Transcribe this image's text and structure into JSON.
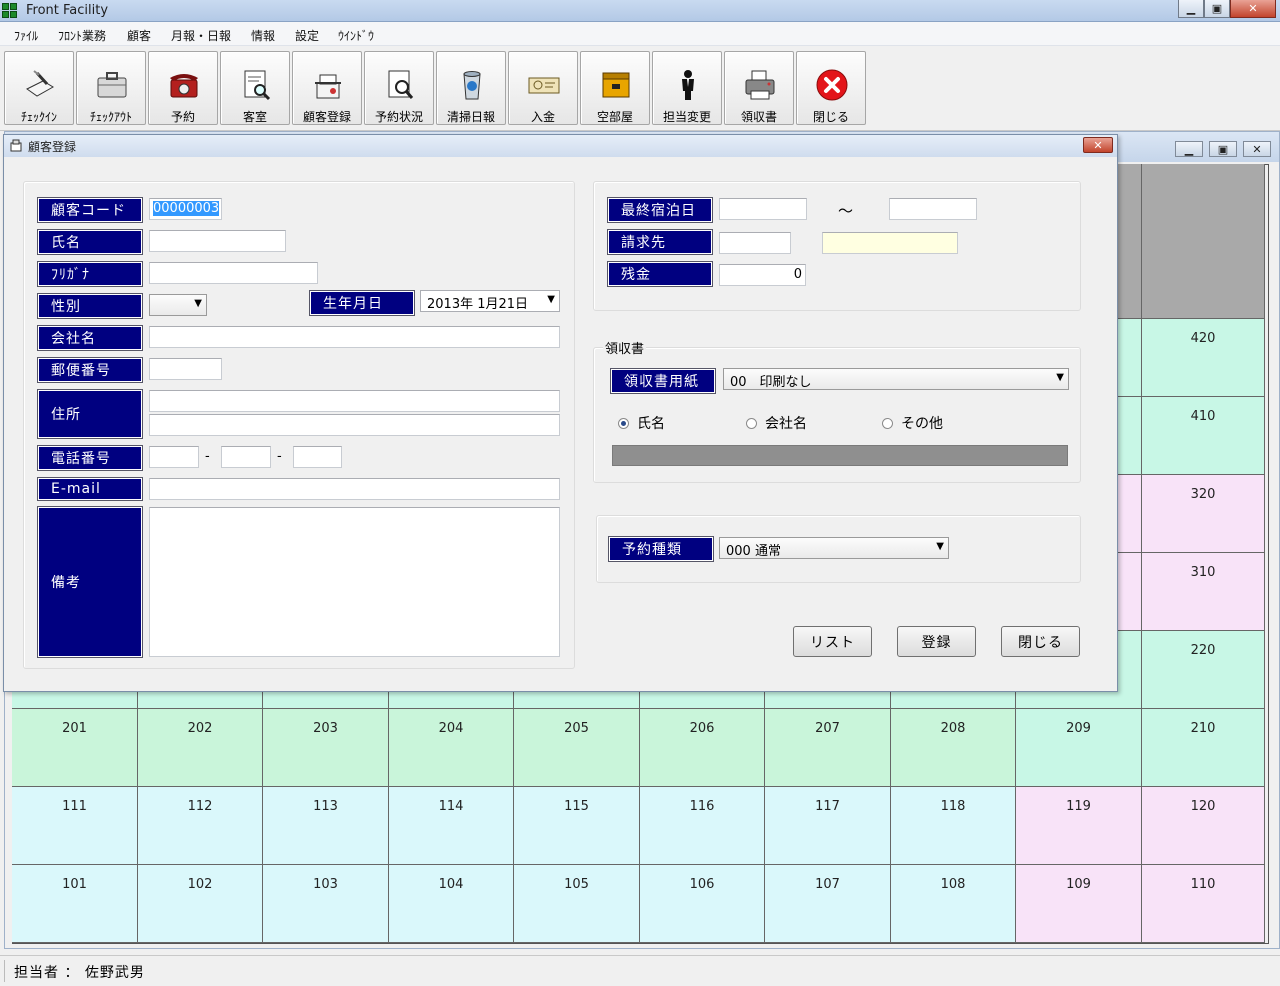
{
  "app": {
    "title": "Front Facility"
  },
  "menu": [
    "ﾌｧｲﾙ",
    "ﾌﾛﾝﾄ業務",
    "顧客",
    "月報・日報",
    "情報",
    "設定",
    "ｳｲﾝﾄﾞｳ"
  ],
  "toolbar": [
    {
      "label": "ﾁｪｯｸｲﾝ",
      "icon": "checkin-icon"
    },
    {
      "label": "ﾁｪｯｸｱｳﾄ",
      "icon": "checkout-icon"
    },
    {
      "label": "予約",
      "icon": "telephone-icon"
    },
    {
      "label": "客室",
      "icon": "room-search-icon"
    },
    {
      "label": "顧客登録",
      "icon": "customer-register-icon"
    },
    {
      "label": "予約状況",
      "icon": "reservation-status-icon"
    },
    {
      "label": "清掃日報",
      "icon": "cleaning-report-icon"
    },
    {
      "label": "入金",
      "icon": "payment-icon"
    },
    {
      "label": "空部屋",
      "icon": "vacant-room-icon"
    },
    {
      "label": "担当変更",
      "icon": "staff-change-icon"
    },
    {
      "label": "領収書",
      "icon": "receipt-printer-icon"
    },
    {
      "label": "閉じる",
      "icon": "close-icon"
    }
  ],
  "rooms": {
    "rows": [
      [
        "",
        "",
        "",
        "",
        "",
        "",
        "",
        "",
        "",
        ""
      ],
      [
        "",
        "",
        "",
        "",
        "",
        "",
        "",
        "",
        "",
        "420"
      ],
      [
        "",
        "",
        "",
        "",
        "",
        "",
        "",
        "",
        "",
        "410"
      ],
      [
        "",
        "",
        "",
        "",
        "",
        "",
        "",
        "",
        "",
        "320"
      ],
      [
        "",
        "",
        "",
        "",
        "",
        "",
        "",
        "",
        "",
        "310"
      ],
      [
        "",
        "",
        "",
        "",
        "",
        "",
        "",
        "",
        "",
        "220"
      ],
      [
        "201",
        "202",
        "203",
        "204",
        "205",
        "206",
        "207",
        "208",
        "209",
        "210"
      ],
      [
        "111",
        "112",
        "113",
        "114",
        "115",
        "116",
        "117",
        "118",
        "119",
        "120"
      ],
      [
        "101",
        "102",
        "103",
        "104",
        "105",
        "106",
        "107",
        "108",
        "109",
        "110"
      ]
    ],
    "colors": {
      "gray": "#a9a9a9",
      "green": "#c9f5da",
      "teal": "#c8f7e6",
      "pink": "#f8e3f8",
      "cyan": "#daf8fb"
    }
  },
  "dialog": {
    "title": "顧客登録",
    "fields": {
      "customer_code_label": "顧客コード",
      "customer_code_value": "00000003",
      "name_label": "氏名",
      "name_value": "",
      "kana_label": "ﾌﾘｶﾞﾅ",
      "kana_value": "",
      "gender_label": "性別",
      "gender_value": "",
      "birthdate_label": "生年月日",
      "birthdate_value": "2013年 1月21日",
      "company_label": "会社名",
      "company_value": "",
      "postal_label": "郵便番号",
      "postal_value": "",
      "address_label": "住所",
      "address1_value": "",
      "address2_value": "",
      "phone_label": "電話番号",
      "phone1_value": "",
      "phone2_value": "",
      "phone3_value": "",
      "phone_sep": "-",
      "email_label": "E-mail",
      "email_value": "",
      "notes_label": "備考",
      "notes_value": ""
    },
    "stay": {
      "last_stay_label": "最終宿泊日",
      "last_stay_from": "",
      "tilde": "～",
      "last_stay_to": "",
      "billing_label": "請求先",
      "billing_code": "",
      "billing_name": "",
      "balance_label": "残金",
      "balance_value": "0"
    },
    "receipt": {
      "group_label": "領収書",
      "paper_label": "領収書用紙",
      "paper_value": "00　印刷なし",
      "options": [
        "氏名",
        "会社名",
        "その他"
      ],
      "selected": "氏名"
    },
    "reservation": {
      "type_label": "予約種類",
      "type_value": "000 通常"
    },
    "buttons": {
      "list": "リスト",
      "register": "登録",
      "close": "閉じる"
    }
  },
  "status": {
    "text": "担当者 ： 佐野武男"
  }
}
